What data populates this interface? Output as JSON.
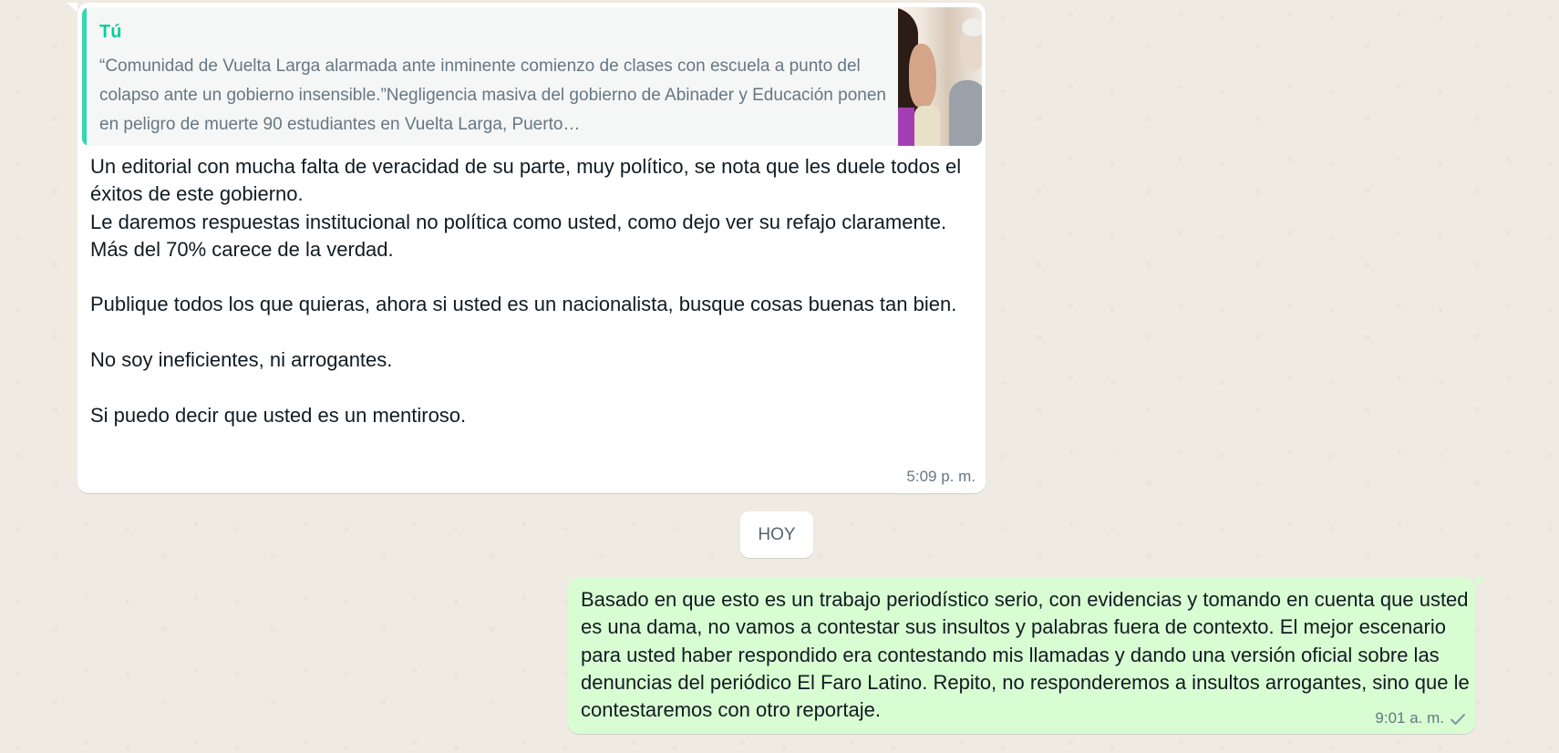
{
  "incoming": {
    "quote": {
      "author": "Tú",
      "text": "“Comunidad de Vuelta Larga alarmada ante inminente comienzo de clases con escuela a punto del colapso ante un gobierno insensible.”Negligencia masiva del gobierno de Abinader y Educación ponen en peligro de muerte 90 estudiantes en Vuelta Larga, Puerto…"
    },
    "body": "Un editorial con mucha falta de veracidad de su parte, muy político, se nota que les duele todos el éxitos de este gobierno.\nLe daremos respuestas institucional no política como usted, como dejo ver su refajo claramente.\nMás del 70% carece de la verdad.\n\nPublique todos los que quieras, ahora si usted es un nacionalista, busque cosas buenas tan bien.\n\nNo soy ineficientes, ni arrogantes.\n\nSi puedo decir que usted es un mentiroso.",
    "time": "5:09 p. m."
  },
  "date_divider": "HOY",
  "outgoing": {
    "body": "Basado en que esto es un trabajo periodístico serio, con evidencias y tomando en cuenta que usted es una dama, no vamos a contestar sus insultos y palabras fuera de contexto. El mejor escenario para usted haber respondido era contestando mis llamadas y dando una versión oficial sobre las denuncias del periódico El Faro Latino. Repito, no responderemos a insultos arrogantes, sino que le contestaremos con otro reportaje.",
    "time": "9:01 a. m.",
    "status_icon": "single-check-icon"
  },
  "colors": {
    "chat_background": "#efeae2",
    "incoming_bubble": "#ffffff",
    "outgoing_bubble": "#d9fdd3",
    "quote_accent": "#06cf9c",
    "meta_text": "#667781"
  }
}
